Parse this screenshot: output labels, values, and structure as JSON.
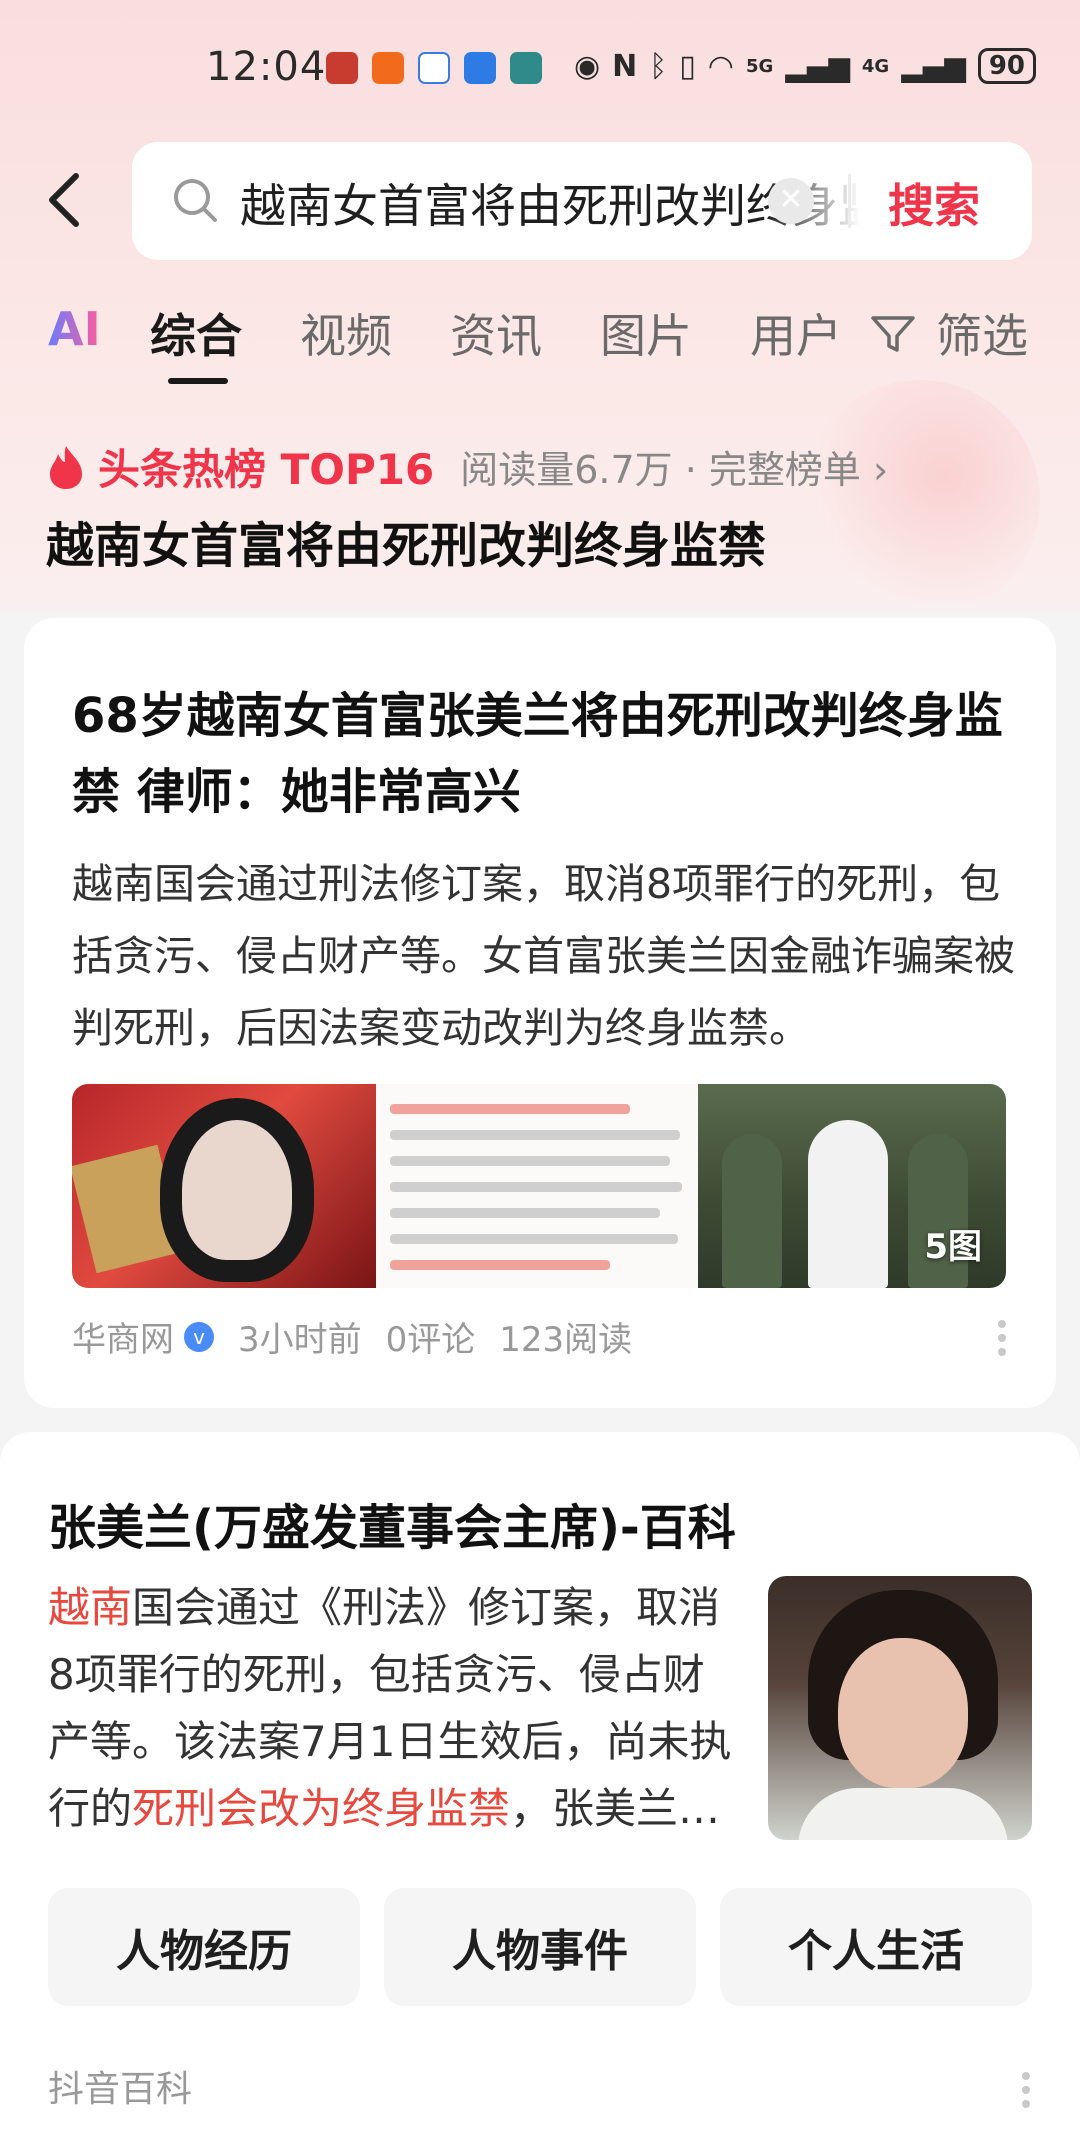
{
  "status_bar": {
    "time": "12:04",
    "network_5g": "5G",
    "network_4g": "4G",
    "battery": "90"
  },
  "search": {
    "query": "越南女首富将由死刑改判终身监禁",
    "submit_label": "搜索"
  },
  "tabs": {
    "ai": "AI",
    "items": [
      "综合",
      "视频",
      "资讯",
      "图片",
      "用户"
    ],
    "active_index": 0,
    "filter_label": "筛选"
  },
  "hot_rank": {
    "label": "头条热榜 TOP16",
    "meta": "阅读量6.7万 · 完整榜单 ›",
    "headline": "越南女首富将由死刑改判终身监禁"
  },
  "article": {
    "title": "68岁越南女首富张美兰将由死刑改判终身监禁 律师：她非常高兴",
    "summary": "越南国会通过刑法修订案，取消8项罪行的死刑，包括贪污、侵占财产等。女首富张美兰因金融诈骗案被判死刑，后因法案变动改判为终身监禁。",
    "image_count": "5图",
    "source": "华商网",
    "time": "3小时前",
    "comments": "0评论",
    "reads": "123阅读"
  },
  "baike": {
    "title": "张美兰(万盛发董事会主席)-百科",
    "text_parts": {
      "p1": "越南",
      "p2": "国会通过《刑法》修订案，取消8项罪行的死刑，包括贪污、侵占财产等。该法案7月1日生效后，尚未执行的",
      "p3": "死刑会改为终身监禁",
      "p4": "，张美兰…"
    },
    "chips": [
      "人物经历",
      "人物事件",
      "个人生活"
    ],
    "source": "抖音百科"
  }
}
